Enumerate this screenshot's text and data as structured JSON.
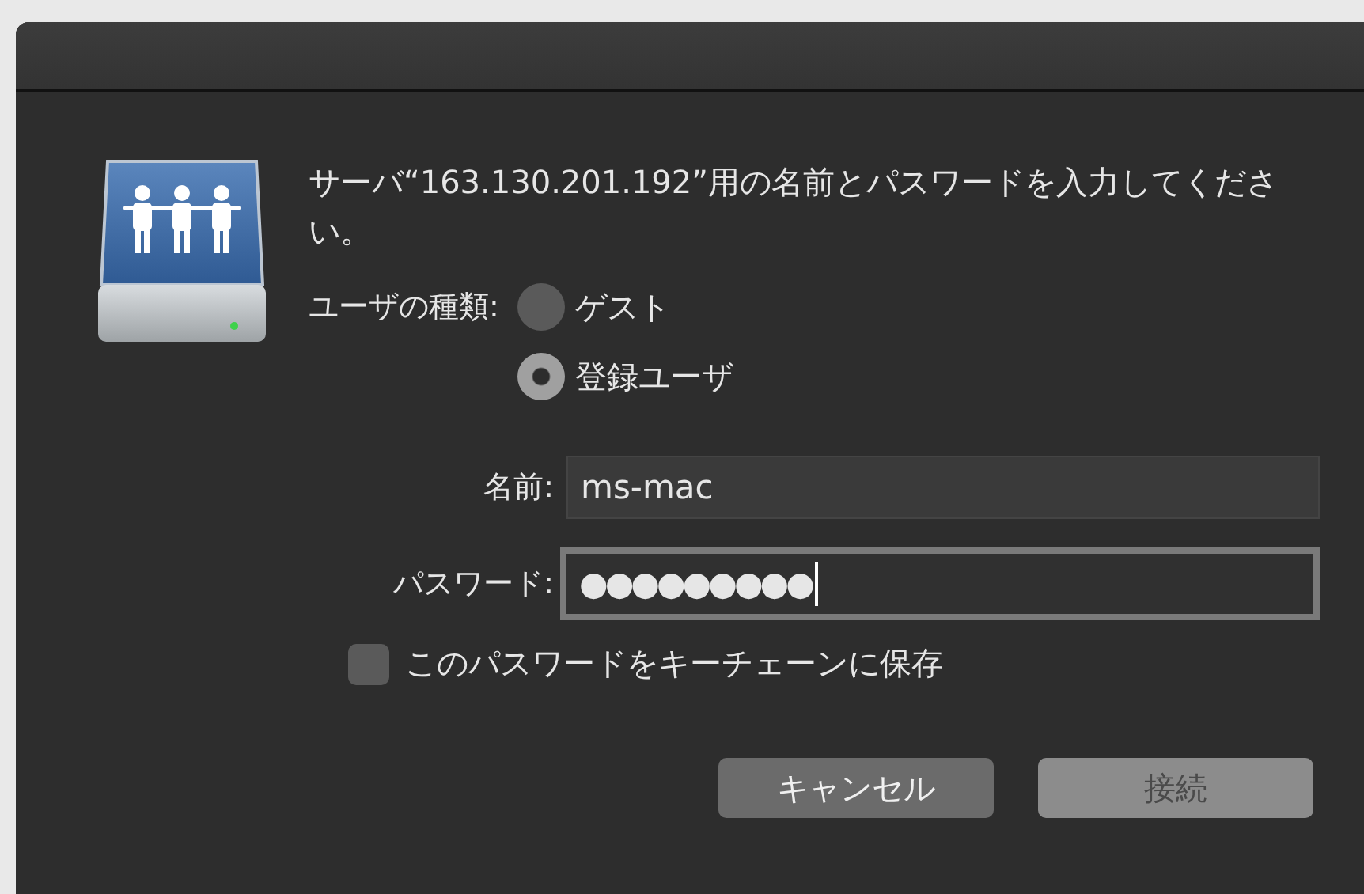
{
  "dialog": {
    "message": "サーバ“163.130.201.192”用の名前とパスワードを入力してください。",
    "user_type": {
      "label": "ユーザの種類:",
      "options": [
        {
          "label": "ゲスト",
          "selected": false
        },
        {
          "label": "登録ユーザ",
          "selected": true
        }
      ]
    },
    "fields": [
      {
        "label": "名前:",
        "value": "ms-mac",
        "focused": false
      },
      {
        "label": "パスワード:",
        "value": "●●●●●●●●●",
        "focused": true
      }
    ],
    "keychain": {
      "label": "このパスワードをキーチェーンに保存",
      "checked": false
    },
    "buttons": [
      {
        "label": "キャンセル",
        "disabled": false
      },
      {
        "label": "接続",
        "disabled": true
      }
    ]
  }
}
